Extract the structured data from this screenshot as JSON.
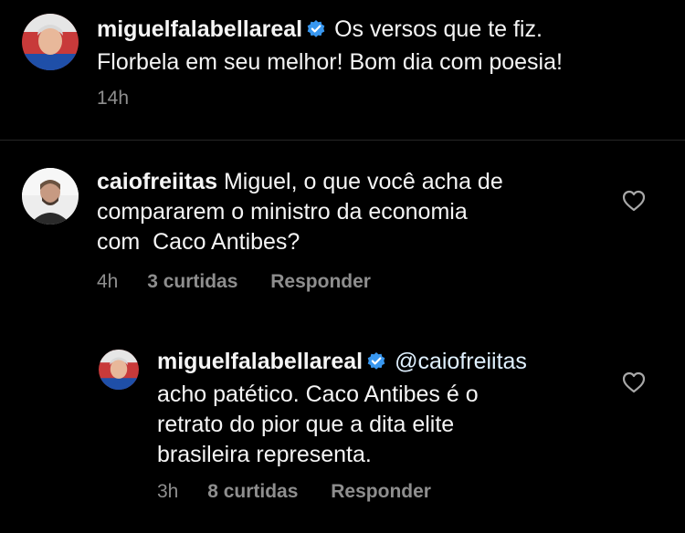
{
  "colors": {
    "background": "#000000",
    "text": "#f5f5f5",
    "muted": "#8e8e8e",
    "verified": "#3897f0",
    "divider": "#262626"
  },
  "caption": {
    "username": "miguelfalabellareal",
    "verified": true,
    "text_line1": "Os versos que te fiz.",
    "text_line2": "Florbela em seu melhor! Bom dia com poesia!",
    "time": "14h"
  },
  "comments": [
    {
      "username": "caiofreiitas",
      "verified": false,
      "line1": "Miguel, o que você acha de",
      "line2": "compararem o ministro da economia",
      "line3": "com  Caco Antibes?",
      "time": "4h",
      "likes": "3 curtidas",
      "reply_label": "Responder",
      "icon": "heart-outline-icon"
    }
  ],
  "reply": {
    "username": "miguelfalabellareal",
    "verified": true,
    "mention": "@caiofreiitas",
    "line2": "acho patético. Caco Antibes é o",
    "line3": "retrato do pior que a dita elite",
    "line4": "brasileira representa.",
    "time": "3h",
    "likes": "8 curtidas",
    "reply_label": "Responder",
    "icon": "heart-outline-icon"
  }
}
